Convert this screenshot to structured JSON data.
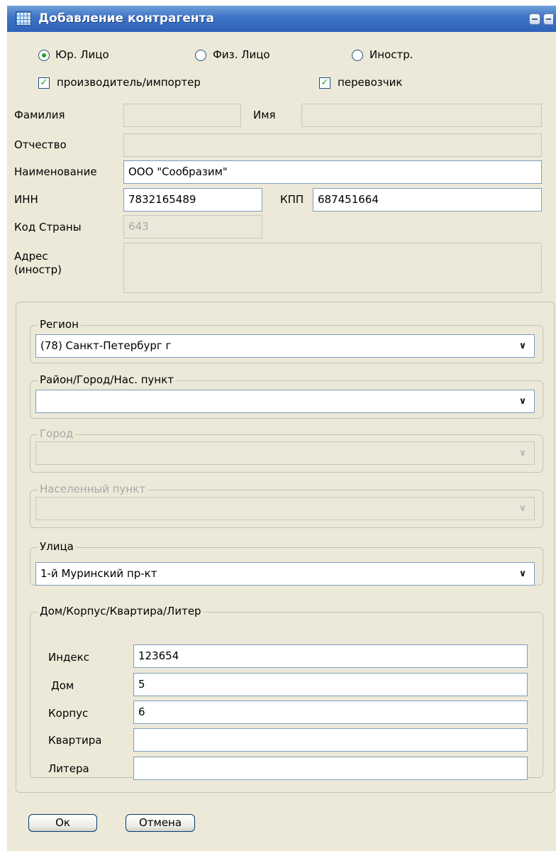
{
  "window": {
    "title": "Добавление контрагента"
  },
  "entity_type": {
    "options": [
      "Юр. Лицо",
      "Физ. Лицо",
      "Иностр."
    ],
    "selected": "Юр. Лицо"
  },
  "flags": {
    "manufacturer_importer": "производитель/импортер",
    "carrier": "перевозчик"
  },
  "fields": {
    "lastname_label": "Фамилия",
    "lastname_value": "",
    "firstname_label": "Имя",
    "firstname_value": "",
    "patronymic_label": "Отчество",
    "patronymic_value": "",
    "name_label": "Наименование",
    "name_value": "ООО \"Сообразим\"",
    "inn_label": "ИНН",
    "inn_value": "7832165489",
    "kpp_label": "КПП",
    "kpp_value": "687451664",
    "country_code_label": "Код Страны",
    "country_code_value": "643",
    "address_foreign_label_line1": "Адрес",
    "address_foreign_label_line2": "(иностр)",
    "address_foreign_value": ""
  },
  "address": {
    "region": {
      "label": "Регион",
      "value": "(78) Санкт-Петербург г"
    },
    "district": {
      "label": "Район/Город/Нас. пункт",
      "value": ""
    },
    "city": {
      "label": "Город",
      "value": ""
    },
    "settlement": {
      "label": "Населенный пункт",
      "value": ""
    },
    "street": {
      "label": "Улица",
      "value": "1-й Муринский пр-кт"
    },
    "house_group": {
      "label": "Дом/Корпус/Квартира/Литер",
      "index_label": "Индекс",
      "index_value": "123654",
      "house_label": "Дом",
      "house_value": "5",
      "building_label": "Корпус",
      "building_value": "6",
      "apartment_label": "Квартира",
      "apartment_value": "",
      "letter_label": "Литера",
      "letter_value": ""
    }
  },
  "buttons": {
    "ok": "Ок",
    "cancel": "Отмена"
  },
  "colors": {
    "titlebar": "#3f73c6",
    "dialog_bg": "#ece9d8",
    "check_mark": "#21a121"
  }
}
